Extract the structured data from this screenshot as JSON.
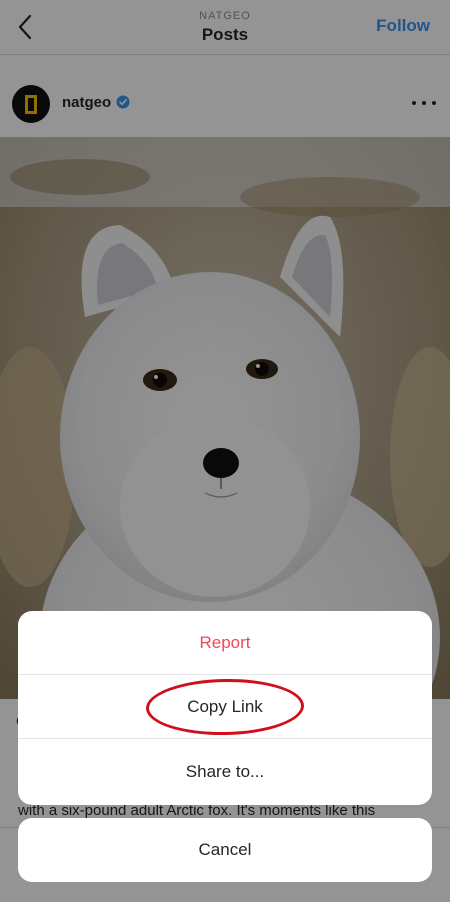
{
  "nav": {
    "subtitle": "NATGEO",
    "title": "Posts",
    "follow_label": "Follow",
    "back_icon": "chevron-left-icon"
  },
  "post": {
    "username": "natgeo",
    "verified_icon": "verified-badge-icon",
    "more_icon": "more-options-icon",
    "photo_subject": "arctic-fox",
    "caption_initial": "C",
    "caption_line": "with a six-pound adult Arctic fox. It's moments like this"
  },
  "sheet": {
    "report_label": "Report",
    "copy_link_label": "Copy Link",
    "share_label": "Share to...",
    "cancel_label": "Cancel"
  },
  "colors": {
    "follow": "#3897f0",
    "report": "#ed4956",
    "highlight": "#d10f1a",
    "verified": "#3897f0",
    "logo_frame": "#f6c300"
  }
}
